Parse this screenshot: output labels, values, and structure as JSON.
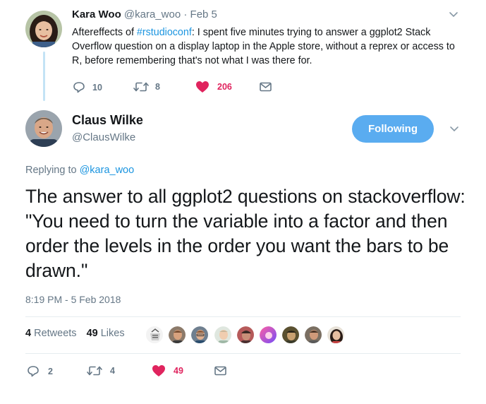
{
  "original_tweet": {
    "name": "Kara Woo",
    "handle": "@kara_woo",
    "separator": "·",
    "date": "Feb 5",
    "text_before": "Aftereffects of ",
    "hashtag": "#rstudioconf",
    "text_after": ": I spent five minutes trying to answer a ggplot2 Stack Overflow question on a display laptop in the Apple store, without a reprex or access to R, before remembering that's not what I was there for.",
    "replies": "10",
    "retweets": "8",
    "likes": "206"
  },
  "main_tweet": {
    "name": "Claus Wilke",
    "handle": "@ClausWilke",
    "follow_label": "Following",
    "replying_prefix": "Replying to ",
    "replying_to": "@kara_woo",
    "text": "The answer to all ggplot2 questions on stackoverflow: \"You need to turn the variable into a factor and then order the levels in the order you want the bars to be drawn.\"",
    "timestamp": "8:19 PM - 5 Feb 2018",
    "retweet_count": "4",
    "retweet_label": "Retweets",
    "like_count": "49",
    "like_label": "Likes",
    "replies": "2",
    "retweets": "4",
    "likes": "49"
  },
  "icons": {
    "reply": "reply-icon",
    "retweet": "retweet-icon",
    "like": "heart-icon",
    "message": "envelope-icon",
    "more": "chevron-down-icon"
  },
  "colors": {
    "link": "#1b95e0",
    "like": "#e0245e",
    "follow_button": "#5aacf0",
    "muted": "#657786",
    "thread_line": "#c4e3f5"
  }
}
